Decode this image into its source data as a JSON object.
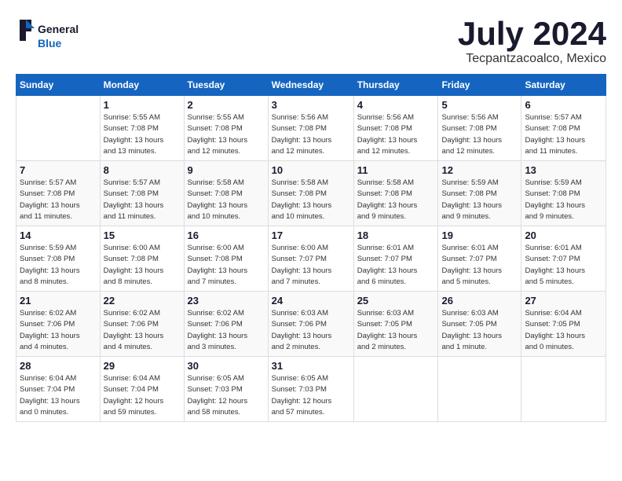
{
  "header": {
    "logo": {
      "line1": "General",
      "line2": "Blue"
    },
    "title": "July 2024",
    "location": "Tecpantzacoalco, Mexico"
  },
  "columns": [
    "Sunday",
    "Monday",
    "Tuesday",
    "Wednesday",
    "Thursday",
    "Friday",
    "Saturday"
  ],
  "weeks": [
    [
      {
        "day": "",
        "info": ""
      },
      {
        "day": "1",
        "info": "Sunrise: 5:55 AM\nSunset: 7:08 PM\nDaylight: 13 hours\nand 13 minutes."
      },
      {
        "day": "2",
        "info": "Sunrise: 5:55 AM\nSunset: 7:08 PM\nDaylight: 13 hours\nand 12 minutes."
      },
      {
        "day": "3",
        "info": "Sunrise: 5:56 AM\nSunset: 7:08 PM\nDaylight: 13 hours\nand 12 minutes."
      },
      {
        "day": "4",
        "info": "Sunrise: 5:56 AM\nSunset: 7:08 PM\nDaylight: 13 hours\nand 12 minutes."
      },
      {
        "day": "5",
        "info": "Sunrise: 5:56 AM\nSunset: 7:08 PM\nDaylight: 13 hours\nand 12 minutes."
      },
      {
        "day": "6",
        "info": "Sunrise: 5:57 AM\nSunset: 7:08 PM\nDaylight: 13 hours\nand 11 minutes."
      }
    ],
    [
      {
        "day": "7",
        "info": "Sunrise: 5:57 AM\nSunset: 7:08 PM\nDaylight: 13 hours\nand 11 minutes."
      },
      {
        "day": "8",
        "info": "Sunrise: 5:57 AM\nSunset: 7:08 PM\nDaylight: 13 hours\nand 11 minutes."
      },
      {
        "day": "9",
        "info": "Sunrise: 5:58 AM\nSunset: 7:08 PM\nDaylight: 13 hours\nand 10 minutes."
      },
      {
        "day": "10",
        "info": "Sunrise: 5:58 AM\nSunset: 7:08 PM\nDaylight: 13 hours\nand 10 minutes."
      },
      {
        "day": "11",
        "info": "Sunrise: 5:58 AM\nSunset: 7:08 PM\nDaylight: 13 hours\nand 9 minutes."
      },
      {
        "day": "12",
        "info": "Sunrise: 5:59 AM\nSunset: 7:08 PM\nDaylight: 13 hours\nand 9 minutes."
      },
      {
        "day": "13",
        "info": "Sunrise: 5:59 AM\nSunset: 7:08 PM\nDaylight: 13 hours\nand 9 minutes."
      }
    ],
    [
      {
        "day": "14",
        "info": "Sunrise: 5:59 AM\nSunset: 7:08 PM\nDaylight: 13 hours\nand 8 minutes."
      },
      {
        "day": "15",
        "info": "Sunrise: 6:00 AM\nSunset: 7:08 PM\nDaylight: 13 hours\nand 8 minutes."
      },
      {
        "day": "16",
        "info": "Sunrise: 6:00 AM\nSunset: 7:08 PM\nDaylight: 13 hours\nand 7 minutes."
      },
      {
        "day": "17",
        "info": "Sunrise: 6:00 AM\nSunset: 7:07 PM\nDaylight: 13 hours\nand 7 minutes."
      },
      {
        "day": "18",
        "info": "Sunrise: 6:01 AM\nSunset: 7:07 PM\nDaylight: 13 hours\nand 6 minutes."
      },
      {
        "day": "19",
        "info": "Sunrise: 6:01 AM\nSunset: 7:07 PM\nDaylight: 13 hours\nand 5 minutes."
      },
      {
        "day": "20",
        "info": "Sunrise: 6:01 AM\nSunset: 7:07 PM\nDaylight: 13 hours\nand 5 minutes."
      }
    ],
    [
      {
        "day": "21",
        "info": "Sunrise: 6:02 AM\nSunset: 7:06 PM\nDaylight: 13 hours\nand 4 minutes."
      },
      {
        "day": "22",
        "info": "Sunrise: 6:02 AM\nSunset: 7:06 PM\nDaylight: 13 hours\nand 4 minutes."
      },
      {
        "day": "23",
        "info": "Sunrise: 6:02 AM\nSunset: 7:06 PM\nDaylight: 13 hours\nand 3 minutes."
      },
      {
        "day": "24",
        "info": "Sunrise: 6:03 AM\nSunset: 7:06 PM\nDaylight: 13 hours\nand 2 minutes."
      },
      {
        "day": "25",
        "info": "Sunrise: 6:03 AM\nSunset: 7:05 PM\nDaylight: 13 hours\nand 2 minutes."
      },
      {
        "day": "26",
        "info": "Sunrise: 6:03 AM\nSunset: 7:05 PM\nDaylight: 13 hours\nand 1 minute."
      },
      {
        "day": "27",
        "info": "Sunrise: 6:04 AM\nSunset: 7:05 PM\nDaylight: 13 hours\nand 0 minutes."
      }
    ],
    [
      {
        "day": "28",
        "info": "Sunrise: 6:04 AM\nSunset: 7:04 PM\nDaylight: 13 hours\nand 0 minutes."
      },
      {
        "day": "29",
        "info": "Sunrise: 6:04 AM\nSunset: 7:04 PM\nDaylight: 12 hours\nand 59 minutes."
      },
      {
        "day": "30",
        "info": "Sunrise: 6:05 AM\nSunset: 7:03 PM\nDaylight: 12 hours\nand 58 minutes."
      },
      {
        "day": "31",
        "info": "Sunrise: 6:05 AM\nSunset: 7:03 PM\nDaylight: 12 hours\nand 57 minutes."
      },
      {
        "day": "",
        "info": ""
      },
      {
        "day": "",
        "info": ""
      },
      {
        "day": "",
        "info": ""
      }
    ]
  ]
}
